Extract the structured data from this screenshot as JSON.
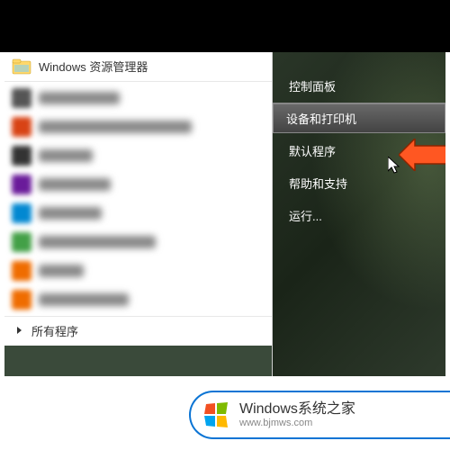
{
  "top_program": {
    "label": "Windows 资源管理器"
  },
  "all_programs_label": "所有程序",
  "right_menu": {
    "items": [
      {
        "label": "控制面板",
        "highlighted": false
      },
      {
        "label": "设备和打印机",
        "highlighted": true
      },
      {
        "label": "默认程序",
        "highlighted": false
      },
      {
        "label": "帮助和支持",
        "highlighted": false
      },
      {
        "label": "运行...",
        "highlighted": false
      }
    ]
  },
  "watermark": {
    "title": "Windows系统之家",
    "url": "www.bjmws.com"
  },
  "blurred_items": [
    {
      "icon_color": "#555555",
      "text_width": 90
    },
    {
      "icon_color": "#d84315",
      "text_width": 170
    },
    {
      "icon_color": "#333333",
      "text_width": 60
    },
    {
      "icon_color": "#6a1b9a",
      "text_width": 80
    },
    {
      "icon_color": "#0288d1",
      "text_width": 70
    },
    {
      "icon_color": "#43a047",
      "text_width": 130
    },
    {
      "icon_color": "#ef6c00",
      "text_width": 50
    },
    {
      "icon_color": "#ef6c00",
      "text_width": 100
    }
  ]
}
